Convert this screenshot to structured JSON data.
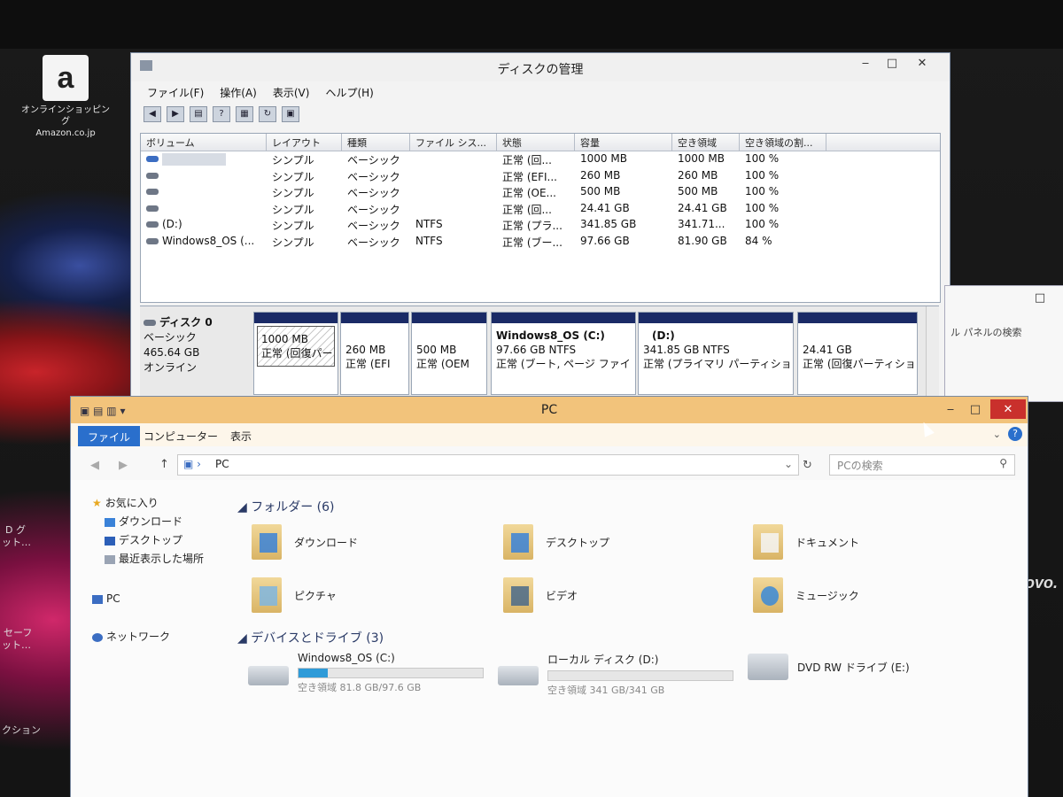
{
  "desktop": {
    "amazon": {
      "line1": "オンラインショッピング",
      "line2": "Amazon.co.jp"
    },
    "side_texts": [
      "D グ",
      "ット…",
      "セーフ",
      "ット…",
      "クション"
    ],
    "brand": "lenovo."
  },
  "disk_mgmt": {
    "title": "ディスクの管理",
    "menu": [
      "ファイル(F)",
      "操作(A)",
      "表示(V)",
      "ヘルプ(H)"
    ],
    "columns": [
      "ボリューム",
      "レイアウト",
      "種類",
      "ファイル シス...",
      "状態",
      "容量",
      "空き領域",
      "空き領域の割..."
    ],
    "rows": [
      {
        "volume": "",
        "layout": "シンプル",
        "type": "ベーシック",
        "fs": "",
        "status": "正常 (回...",
        "capacity": "1000 MB",
        "free": "1000 MB",
        "pct": "100 %"
      },
      {
        "volume": "",
        "layout": "シンプル",
        "type": "ベーシック",
        "fs": "",
        "status": "正常 (EFI...",
        "capacity": "260 MB",
        "free": "260 MB",
        "pct": "100 %"
      },
      {
        "volume": "",
        "layout": "シンプル",
        "type": "ベーシック",
        "fs": "",
        "status": "正常 (OE...",
        "capacity": "500 MB",
        "free": "500 MB",
        "pct": "100 %"
      },
      {
        "volume": "",
        "layout": "シンプル",
        "type": "ベーシック",
        "fs": "",
        "status": "正常 (回...",
        "capacity": "24.41 GB",
        "free": "24.41 GB",
        "pct": "100 %"
      },
      {
        "volume": "(D:)",
        "layout": "シンプル",
        "type": "ベーシック",
        "fs": "NTFS",
        "status": "正常 (プラ...",
        "capacity": "341.85 GB",
        "free": "341.71...",
        "pct": "100 %"
      },
      {
        "volume": "Windows8_OS (...",
        "layout": "シンプル",
        "type": "ベーシック",
        "fs": "NTFS",
        "status": "正常 (ブー...",
        "capacity": "97.66 GB",
        "free": "81.90 GB",
        "pct": "84 %"
      }
    ],
    "disk": {
      "name": "ディスク 0",
      "type": "ベーシック",
      "size": "465.64 GB",
      "state": "オンライン"
    },
    "partitions": [
      {
        "title": "",
        "line1": "1000 MB",
        "line2": "正常 (回復パー"
      },
      {
        "title": "",
        "line1": "260 MB",
        "line2": "正常 (EFI"
      },
      {
        "title": "",
        "line1": "500 MB",
        "line2": "正常 (OEM"
      },
      {
        "title": "Windows8_OS  (C:)",
        "line1": "97.66 GB NTFS",
        "line2": "正常 (ブート, ページ ファイ"
      },
      {
        "title": "(D:)",
        "line1": "341.85 GB NTFS",
        "line2": "正常 (プライマリ パーティション)"
      },
      {
        "title": "",
        "line1": "24.41 GB",
        "line2": "正常 (回復パーティション"
      }
    ]
  },
  "control_panel": {
    "search": "ル パネルの検索"
  },
  "explorer": {
    "title": "PC",
    "tabs": [
      "ファイル",
      "コンピューター",
      "表示"
    ],
    "address": "PC",
    "search_placeholder": "PCの検索",
    "nav": {
      "favorites": "お気に入り",
      "downloads": "ダウンロード",
      "desktop": "デスクトップ",
      "recent": "最近表示した場所",
      "pc": "PC",
      "network": "ネットワーク"
    },
    "folders_header": "フォルダー (6)",
    "folders": [
      "ダウンロード",
      "デスクトップ",
      "ドキュメント",
      "ピクチャ",
      "ビデオ",
      "ミュージック"
    ],
    "devices_header": "デバイスとドライブ (3)",
    "drives": [
      {
        "name": "Windows8_OS (C:)",
        "sub": "空き領域 81.8 GB/97.6 GB",
        "used_fraction": 0.16
      },
      {
        "name": "ローカル ディスク (D:)",
        "sub": "空き領域 341 GB/341 GB",
        "used_fraction": 0.0
      },
      {
        "name": "DVD RW ドライブ (E:)",
        "sub": ""
      }
    ]
  },
  "colors": {
    "explorer_title": "#f2c37b",
    "file_tab": "#2a6fcc",
    "partition_bar": "#1a2a66",
    "drive_fill": "#2f9bd8"
  }
}
